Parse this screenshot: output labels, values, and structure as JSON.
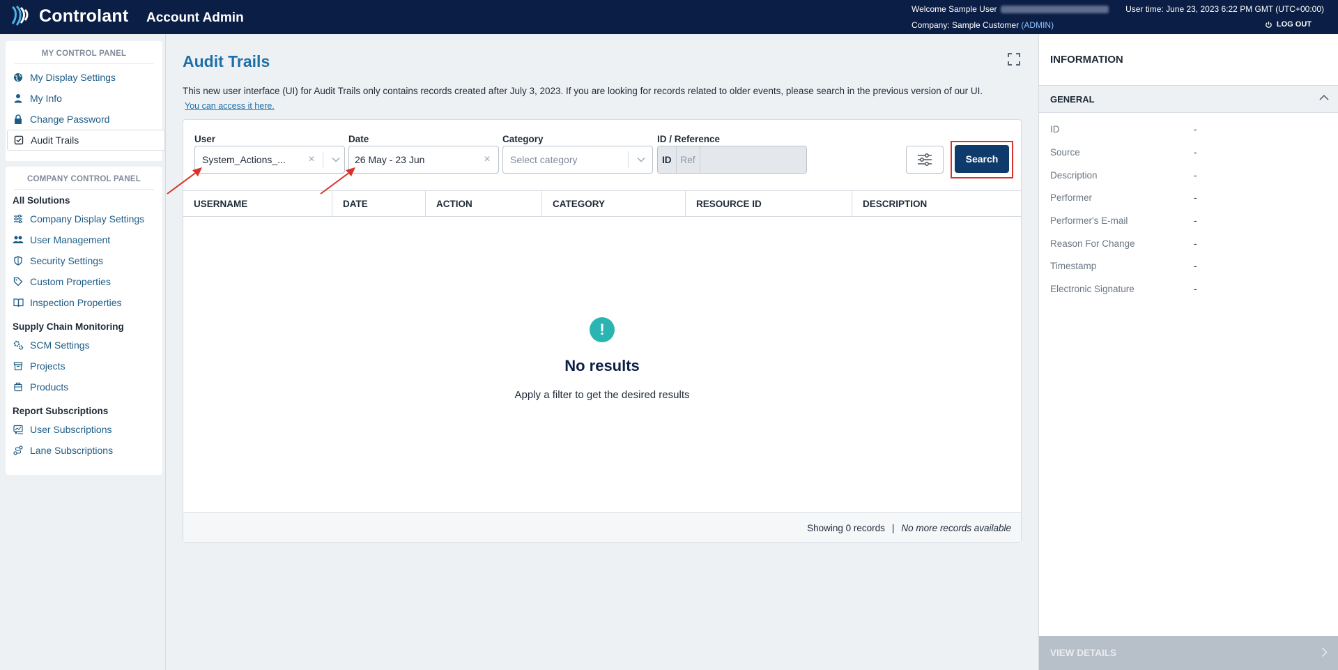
{
  "header": {
    "brand": "Controlant",
    "app_title": "Account Admin",
    "welcome": "Welcome Sample User",
    "company_label": "Company: Sample Customer",
    "company_role": "(ADMIN)",
    "user_time": "User time: June 23, 2023 6:22 PM GMT (UTC+00:00)",
    "logout": "LOG OUT"
  },
  "sidebar": {
    "my_panel_title": "MY CONTROL PANEL",
    "my_items": [
      {
        "label": "My Display Settings",
        "icon": "globe-icon"
      },
      {
        "label": "My Info",
        "icon": "user-icon"
      },
      {
        "label": "Change Password",
        "icon": "lock-icon"
      },
      {
        "label": "Audit Trails",
        "icon": "checkbox-icon",
        "active": true
      }
    ],
    "company_panel_title": "COMPANY CONTROL PANEL",
    "groups": [
      {
        "title": "All Solutions",
        "items": [
          {
            "label": "Company Display Settings",
            "icon": "sliders-icon"
          },
          {
            "label": "User Management",
            "icon": "users-icon"
          },
          {
            "label": "Security Settings",
            "icon": "shield-icon"
          },
          {
            "label": "Custom Properties",
            "icon": "tag-icon"
          },
          {
            "label": "Inspection Properties",
            "icon": "book-icon"
          }
        ]
      },
      {
        "title": "Supply Chain Monitoring",
        "items": [
          {
            "label": "SCM Settings",
            "icon": "gears-icon"
          },
          {
            "label": "Projects",
            "icon": "archive-icon"
          },
          {
            "label": "Products",
            "icon": "package-icon"
          }
        ]
      },
      {
        "title": "Report Subscriptions",
        "items": [
          {
            "label": "User Subscriptions",
            "icon": "report-icon"
          },
          {
            "label": "Lane Subscriptions",
            "icon": "route-icon"
          }
        ]
      }
    ]
  },
  "main": {
    "title": "Audit Trails",
    "notice": "This new user interface (UI) for Audit Trails only contains records created after July 3, 2023. If you are looking for records related to older events, please search in the previous version of our UI.",
    "notice_link": "You can access it here.",
    "filters": {
      "user_label": "User",
      "user_value": "System_Actions_...",
      "date_label": "Date",
      "date_value": "26 May - 23 Jun",
      "category_label": "Category",
      "category_placeholder": "Select category",
      "idref_label": "ID / Reference",
      "id_toggle": "ID",
      "ref_toggle": "Ref",
      "search_button": "Search"
    },
    "table": {
      "columns": [
        "USERNAME",
        "DATE",
        "ACTION",
        "CATEGORY",
        "RESOURCE ID",
        "DESCRIPTION"
      ],
      "rows": []
    },
    "empty": {
      "title": "No results",
      "subtitle": "Apply a filter to get the desired results"
    },
    "footer": {
      "showing": "Showing 0 records",
      "separator": "|",
      "more": "No more records available"
    }
  },
  "info": {
    "title": "INFORMATION",
    "section": "GENERAL",
    "fields": [
      {
        "label": "ID",
        "value": "-"
      },
      {
        "label": "Source",
        "value": "-"
      },
      {
        "label": "Description",
        "value": "-"
      },
      {
        "label": "Performer",
        "value": "-"
      },
      {
        "label": "Performer's E-mail",
        "value": "-"
      },
      {
        "label": "Reason For Change",
        "value": "-"
      },
      {
        "label": "Timestamp",
        "value": "-"
      },
      {
        "label": "Electronic Signature",
        "value": "-"
      }
    ],
    "view_details": "VIEW DETAILS"
  },
  "colors": {
    "topbar": "#0b1e45",
    "accent": "#1e6fa8",
    "primary_button": "#0f3b6c",
    "highlight": "#d9322b",
    "empty_icon": "#2bb5b2"
  }
}
